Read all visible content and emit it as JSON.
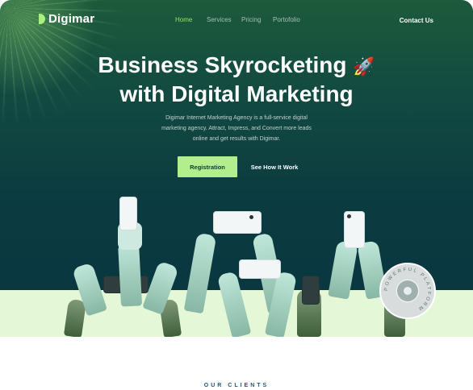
{
  "brand": {
    "name": "Digimar"
  },
  "nav": {
    "items": [
      {
        "label": "Home",
        "active": true
      },
      {
        "label": "Services",
        "active": false
      },
      {
        "label": "Pricing",
        "active": false
      },
      {
        "label": "Portofolio",
        "active": false
      }
    ],
    "contact_label": "Contact Us"
  },
  "hero": {
    "title_line1": "Business Skyrocketing",
    "title_rocket": "🚀",
    "title_line2": "with Digital Marketing",
    "subtitle": "Digimar Internet Marketing Agency is a full-service digital marketing agency. Attract, Impress, and Convert more leads online and get results with Digimar.",
    "primary_button": "Registration",
    "secondary_button": "See How It Work",
    "badge_text": "POWERFUL PLATFORM"
  },
  "clients": {
    "heading": "OUR CLIENTS"
  },
  "colors": {
    "accent": "#b2ef8c",
    "hero_dark": "#0b3b40",
    "hero_green": "#1d5a3c",
    "band": "#e4f7d6",
    "clients_heading": "#1e5a78"
  }
}
